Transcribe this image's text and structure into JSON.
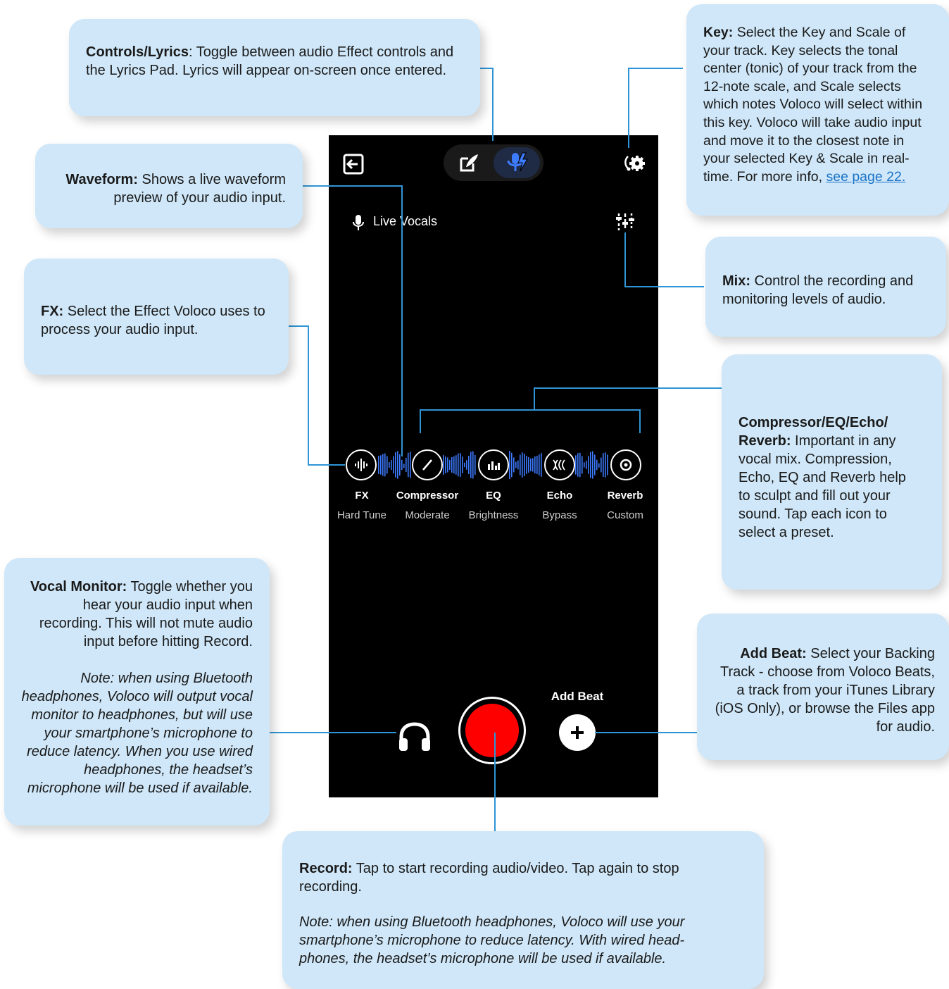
{
  "callouts": {
    "controls": {
      "title": "Controls/Lyrics",
      "sep": ": ",
      "body": "Toggle between audio Effect controls and the Lyrics Pad. Lyrics will appear on-screen once entered."
    },
    "waveform": {
      "title": "Waveform:",
      "body": " Shows a live waveform preview of your audio input."
    },
    "fx": {
      "title": "FX:",
      "body": " Select the Effect Voloco uses to process your audio input."
    },
    "key": {
      "title": "Key:",
      "body": " Select the Key and Scale of your track. Key selects the tonal center (tonic) of your track from the 12-note scale, and Scale selects which notes Voloco will select within this key. Voloco will take audio input and move it to the closest note in your selected Key & Scale in real-time. For more info, ",
      "link": "see page 22."
    },
    "mix": {
      "title": "Mix:",
      "body": " Control the recording and monitoring levels of audio."
    },
    "compressor": {
      "title": "Compressor/EQ/Echo/ Reverb:",
      "body": " Important in any vocal mix. Compression, Echo, EQ and Reverb help to sculpt and fill out your sound. Tap each icon to select a preset."
    },
    "vocal_monitor": {
      "title": "Vocal Monitor:",
      "body": " Toggle whether you hear your audio input when recording. This will not mute audio input before hitting Record.",
      "note": "Note: when using Bluetooth headphones, Voloco will output vocal monitor to headphones, but will use your smartphone’s microphone to reduce latency. When you use wired headphones, the headset’s microphone will be used if available."
    },
    "add_beat": {
      "title": "Add Beat:",
      "body": " Select your Backing Track - choose from Voloco Beats, a track from your iTunes Library (iOS Only), or browse the Files app for audio."
    },
    "record": {
      "title": "Record:",
      "body": " Tap to start recording audio/video. Tap again to stop recording.",
      "note": "Note: when using Bluetooth headphones, Voloco will use your smartphone’s microphone to reduce latency. With wired head-phones, the headset’s microphone will be used if available."
    }
  },
  "phone": {
    "live_vocals": "Live Vocals",
    "add_beat_label": "Add Beat",
    "effects": [
      {
        "name": "FX",
        "value": "Hard Tune",
        "icon": "waveform-icon"
      },
      {
        "name": "Compressor",
        "value": "Moderate",
        "icon": "compressor-icon"
      },
      {
        "name": "EQ",
        "value": "Brightness",
        "icon": "eq-icon"
      },
      {
        "name": "Echo",
        "value": "Bypass",
        "icon": "echo-icon"
      },
      {
        "name": "Reverb",
        "value": "Custom",
        "icon": "reverb-icon"
      }
    ]
  },
  "colors": {
    "callout_bg": "#cfe7f8",
    "connector": "#2f95d6",
    "accent_blue": "#3d7bff",
    "record_red": "#ff0000"
  }
}
